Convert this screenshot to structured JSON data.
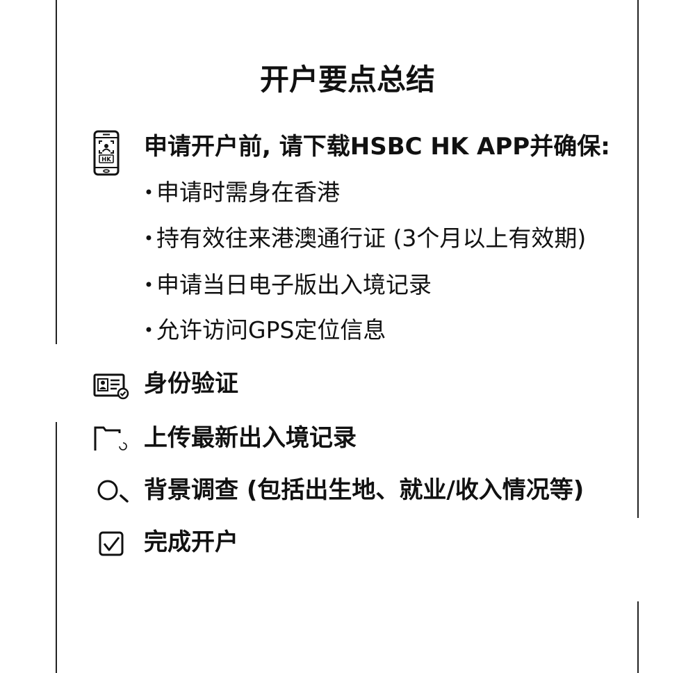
{
  "title": "开户要点总结",
  "bullet_marker": "•",
  "steps": [
    {
      "icon": "phone-icon",
      "icon_text": "HK",
      "label": "申请开户前, 请下载HSBC HK APP并确保:",
      "bullets": [
        "申请时需身在香港",
        "持有效往来港澳通行证 (3个月以上有效期)",
        "申请当日电子版出入境记录",
        "允许访问GPS定位信息"
      ]
    },
    {
      "icon": "id-card-icon",
      "label": "身份验证"
    },
    {
      "icon": "folder-upload-icon",
      "label": "上传最新出入境记录"
    },
    {
      "icon": "magnifier-icon",
      "label": "背景调查 (包括出生地、就业/收入情况等)"
    },
    {
      "icon": "checkbox-icon",
      "label": "完成开户"
    }
  ],
  "colors": {
    "text": "#111111",
    "background": "#ffffff",
    "border": "#222222"
  }
}
